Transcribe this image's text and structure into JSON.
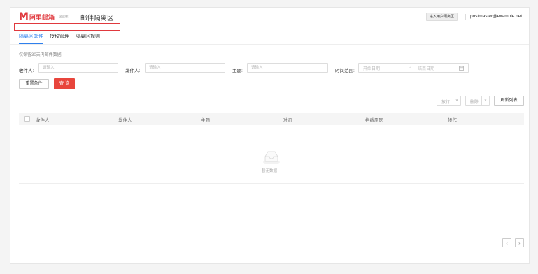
{
  "header": {
    "logo_mark": "M",
    "logo_text": "阿里邮箱",
    "logo_edition": "企业版",
    "page_title": "邮件隔离区",
    "enter_button": "进入用户隔离区",
    "user_email": "postmaster@example.net"
  },
  "tabs": [
    {
      "label": "隔离区邮件",
      "active": true
    },
    {
      "label": "授权管理",
      "active": false
    },
    {
      "label": "隔离区规则",
      "active": false
    }
  ],
  "hint": "仅保留30天内邮件数据",
  "filters": {
    "recipient_label": "收件人:",
    "recipient_placeholder": "请输入",
    "sender_label": "发件人:",
    "sender_placeholder": "请输入",
    "subject_label": "主题:",
    "subject_placeholder": "请输入",
    "time_label": "时间范围:",
    "start_placeholder": "开始日期",
    "range_arrow": "→",
    "end_placeholder": "结束日期"
  },
  "buttons": {
    "reset": "重置条件",
    "query": "查 询",
    "release": "放行",
    "delete": "删除",
    "dropdown": "∨",
    "refresh": "刷新列表"
  },
  "table": {
    "columns": [
      "收件人",
      "发件人",
      "主题",
      "时间",
      "拦截原因",
      "操作"
    ],
    "empty_text": "暂无数据"
  },
  "pagination": {
    "prev": "‹",
    "next": "›"
  },
  "colors": {
    "brand": "#e0393e",
    "accent": "#2f80ed",
    "primary_button": "#e8453c"
  }
}
